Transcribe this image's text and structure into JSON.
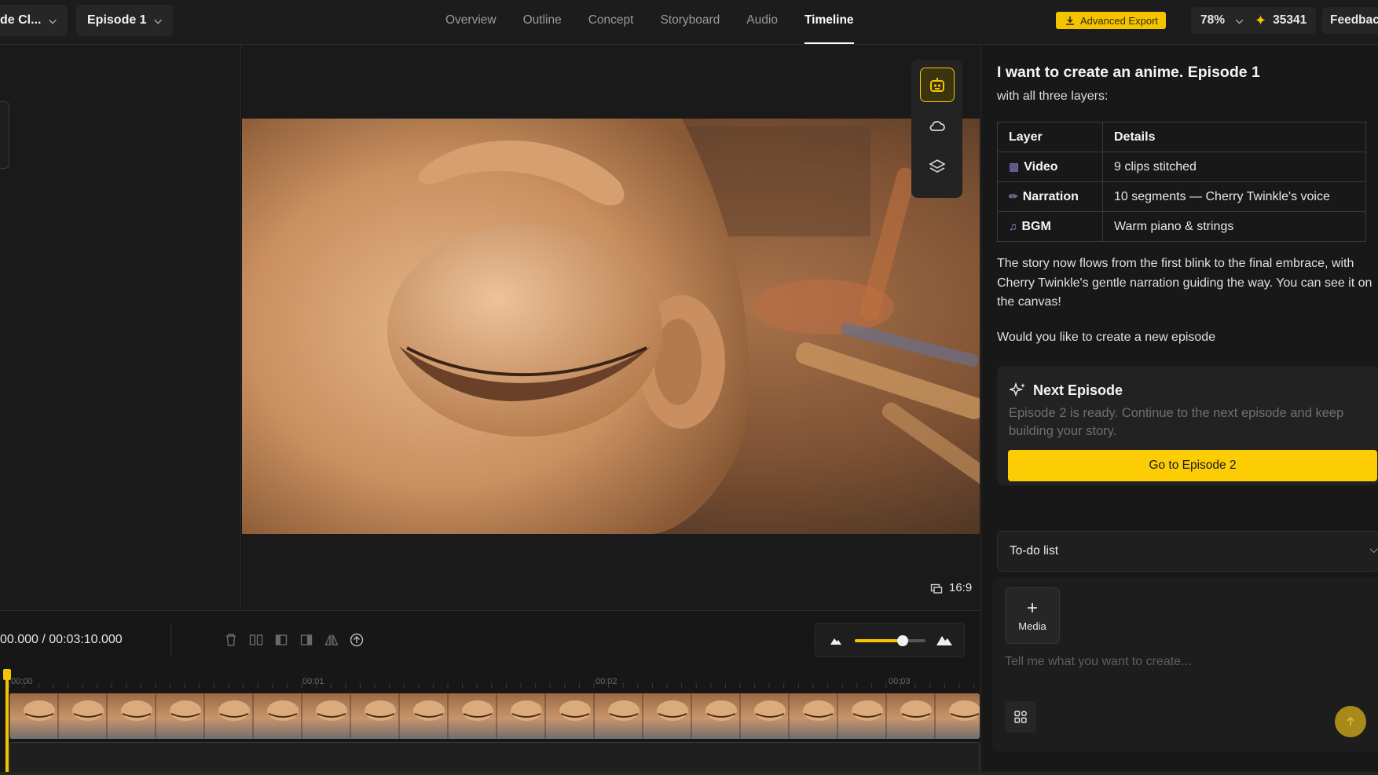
{
  "topbar": {
    "project_label": "de Cl...",
    "episode_label": "Episode 1",
    "tabs": [
      {
        "label": "Overview"
      },
      {
        "label": "Outline"
      },
      {
        "label": "Concept"
      },
      {
        "label": "Storyboard"
      },
      {
        "label": "Audio"
      },
      {
        "label": "Timeline"
      }
    ],
    "active_tab": "Timeline",
    "export_label": "Advanced Export",
    "zoom_label": "78%",
    "credits_label": "35341",
    "feedback_label": "Feedback",
    "accent_color": "#f5c400"
  },
  "preview": {
    "aspect_label": "16:9",
    "rail_icons": [
      "robot-icon",
      "cloud-icon",
      "layers-icon"
    ]
  },
  "timeline": {
    "timecode": "00.000 / 00:03:10.000",
    "ruler_labels": [
      "00:00",
      "00:01",
      "00:02",
      "00:03"
    ],
    "zoom_level": 0.68,
    "tool_icons": [
      "delete-icon",
      "split-icon",
      "trim-left-icon",
      "trim-right-icon",
      "flip-icon",
      "upload-icon"
    ]
  },
  "chat": {
    "title": "I want to create an anime. Episode 1",
    "subtitle": "with all three layers:",
    "table": {
      "headers": [
        "Layer",
        "Details"
      ],
      "rows": [
        {
          "icon": "video-icon",
          "layer": "Video",
          "details": "9 clips stitched"
        },
        {
          "icon": "microphone-icon",
          "layer": "Narration",
          "details": "10 segments — Cherry Twinkle's voice"
        },
        {
          "icon": "music-note-icon",
          "layer": "BGM",
          "details": "Warm piano & strings"
        }
      ]
    },
    "paragraph": "The story now flows from the first blink to the final embrace, with Cherry Twinkle's gentle narration guiding the way. You can see it on the canvas!",
    "question": "Would you like to create a new episode",
    "next_card": {
      "title": "Next Episode",
      "description": "Episode 2 is ready. Continue to the next episode and keep building your story.",
      "button_label": "Go to Episode 2"
    },
    "todo_label": "To-do list",
    "composer": {
      "media_label": "Media",
      "placeholder": "Tell me what you want to create..."
    }
  }
}
